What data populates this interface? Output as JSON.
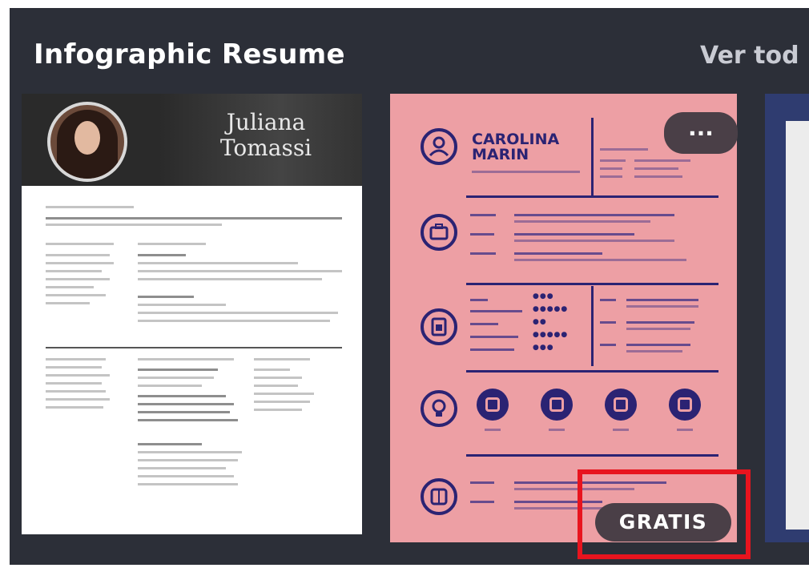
{
  "section": {
    "title": "Infographic Resume",
    "see_all_label": "Ver tod"
  },
  "cards": [
    {
      "name_line1": "Juliana",
      "name_line2": "Tomassi"
    },
    {
      "name_line1": "CAROLINA",
      "name_line2": "MARIN",
      "more_label": "...",
      "badge": "GRATIS"
    }
  ],
  "icons": {
    "more": "more-options-icon",
    "profile": "user-icon",
    "experience": "briefcase-icon",
    "skills": "clipboard-icon",
    "interests": "lightbulb-icon",
    "education": "book-icon"
  },
  "colors": {
    "panel_bg": "#2c2f38",
    "card2_bg": "#ed9fa4",
    "card2_ink": "#2b2373",
    "badge_bg": "#4a3f47",
    "highlight": "#e8141e"
  }
}
